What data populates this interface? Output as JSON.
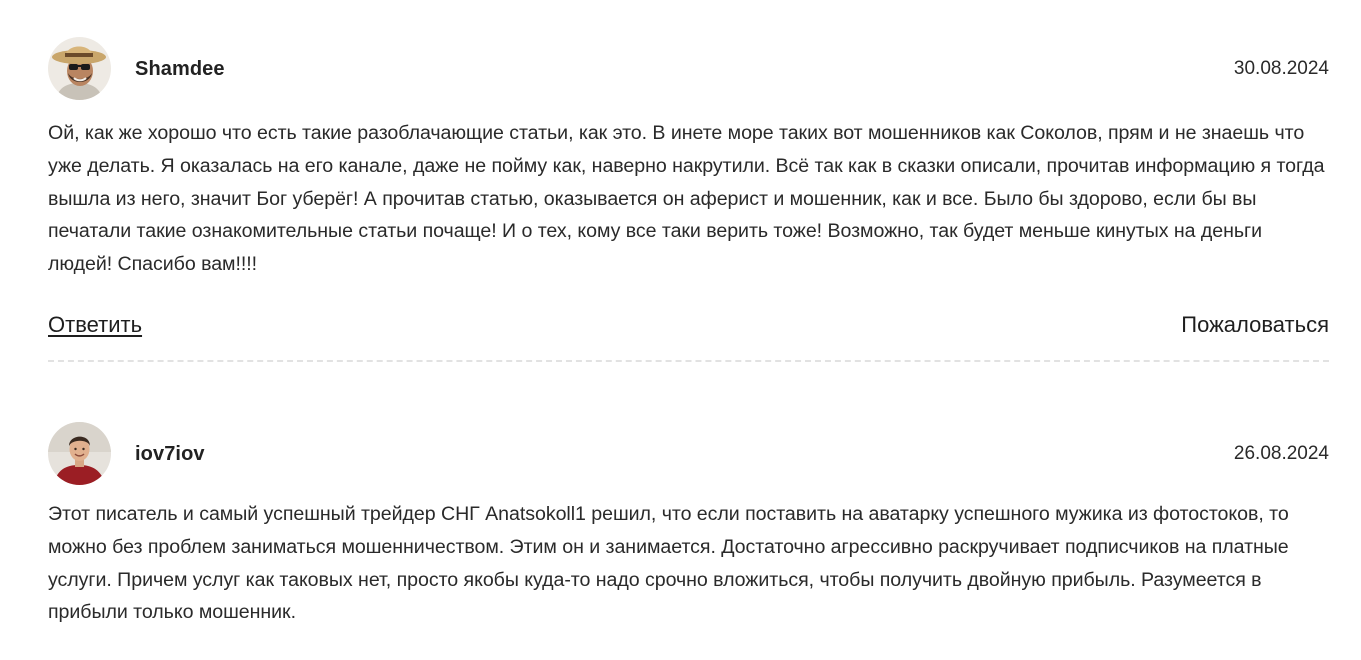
{
  "comments": [
    {
      "author": "Shamdee",
      "date": "30.08.2024",
      "text": "Ой, как же хорошо что есть такие разоблачающие статьи, как это. В инете море таких вот мошенников как Соколов, прям и не знаешь что уже делать. Я оказалась на его канале, даже не пойму как, наверно накрутили. Всё так как в сказки описали, прочитав информацию я тогда вышла из него, значит Бог уберёг! А прочитав статью, оказывается он аферист и мошенник, как и все. Было бы здорово, если бы вы печатали такие ознакомительные статьи почаще! И о тех, кому все таки верить тоже! Возможно, так будет меньше кинутых на деньги людей! Спасибо вам!!!!",
      "reply_label": "Ответить",
      "report_label": "Пожаловаться"
    },
    {
      "author": "iov7iov",
      "date": "26.08.2024",
      "text": "Этот писатель и самый успешный трейдер СНГ Anatsokoll1 решил, что если поставить на аватарку успешного мужика из фотостоков, то можно без проблем заниматься мошенничеством. Этим он и занимается. Достаточно агрессивно раскручивает подписчиков на платные услуги. Причем услуг как таковых нет, просто якобы куда-то надо срочно вложиться, чтобы получить двойную прибыль. Разумеется в прибыли только мошенник."
    }
  ]
}
